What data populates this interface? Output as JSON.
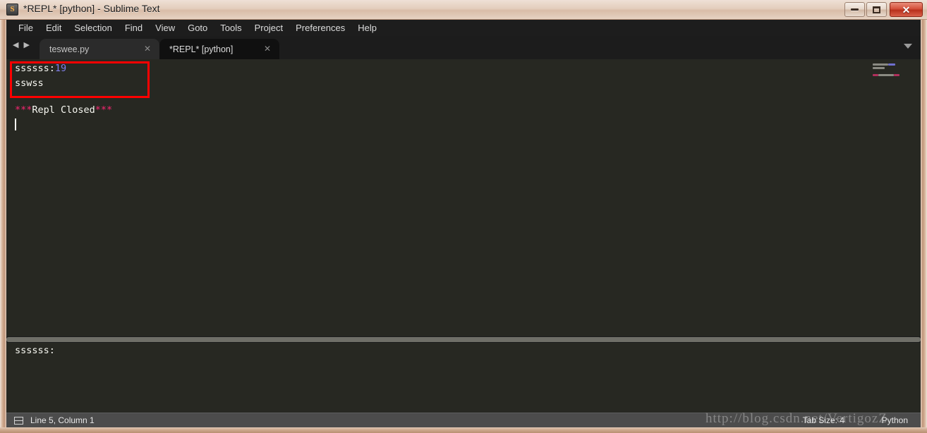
{
  "window": {
    "title": "*REPL* [python] - Sublime Text",
    "app_icon": "sublime-icon",
    "controls": {
      "minimize": "minimize-icon",
      "maximize": "maximize-icon",
      "close": "✕"
    }
  },
  "menubar": {
    "items": [
      {
        "label": "File"
      },
      {
        "label": "Edit"
      },
      {
        "label": "Selection"
      },
      {
        "label": "Find"
      },
      {
        "label": "View"
      },
      {
        "label": "Goto"
      },
      {
        "label": "Tools"
      },
      {
        "label": "Project"
      },
      {
        "label": "Preferences"
      },
      {
        "label": "Help"
      }
    ]
  },
  "tabbar": {
    "prev_arrow": "◀",
    "next_arrow": "▶",
    "close_glyph": "✕",
    "tabs": [
      {
        "label": "teswee.py",
        "active": false
      },
      {
        "label": "*REPL* [python]",
        "active": true
      }
    ]
  },
  "editor": {
    "lines": [
      {
        "prefix": "ssssss:",
        "number": "19"
      },
      {
        "text": "sswss"
      },
      {
        "stars_left": "***",
        "text": "Repl Closed",
        "stars_right": "***"
      }
    ],
    "annotation": {
      "color": "#ff0000"
    }
  },
  "panel": {
    "input_value": "ssssss:"
  },
  "statusbar": {
    "panel_icon": "panel-icon",
    "position": "Line 5, Column 1",
    "tab_size": "Tab Size: 4",
    "syntax": "Python"
  },
  "watermark": {
    "text": "http://blog.csdn.net/VertigozZ"
  },
  "colors": {
    "editor_bg": "#272822",
    "text": "#f8f8f2",
    "number": "#7f7fe8",
    "keyword": "#f92672",
    "annotation": "#ff0000",
    "chrome": "#1c1c1c",
    "status_bg": "#4c4c4c"
  }
}
